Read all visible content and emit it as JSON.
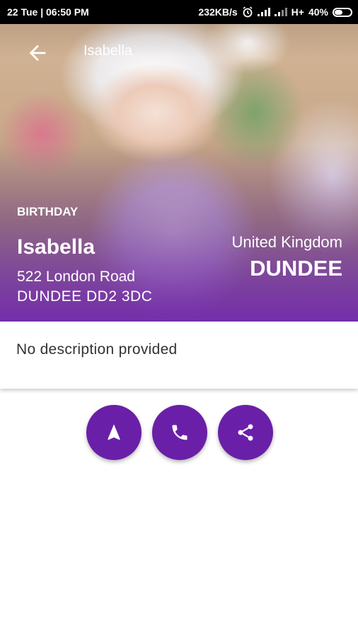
{
  "status_bar": {
    "date_time": "22 Tue | 06:50 PM",
    "speed": "232KB/s",
    "network": "H+",
    "battery": "40%"
  },
  "app_bar": {
    "title": "Isabella",
    "back_icon": "arrow-left-icon"
  },
  "event": {
    "type": "BIRTHDAY",
    "name": "Isabella",
    "address_line1": "522 London Road",
    "address_line2": "DUNDEE DD2 3DC",
    "country": "United Kingdom",
    "city": "DUNDEE"
  },
  "description": "No description provided",
  "actions": [
    {
      "icon": "navigation-icon"
    },
    {
      "icon": "phone-icon"
    },
    {
      "icon": "share-icon"
    }
  ],
  "colors": {
    "accent": "#6a1fa8",
    "status_bar": "#000000"
  }
}
